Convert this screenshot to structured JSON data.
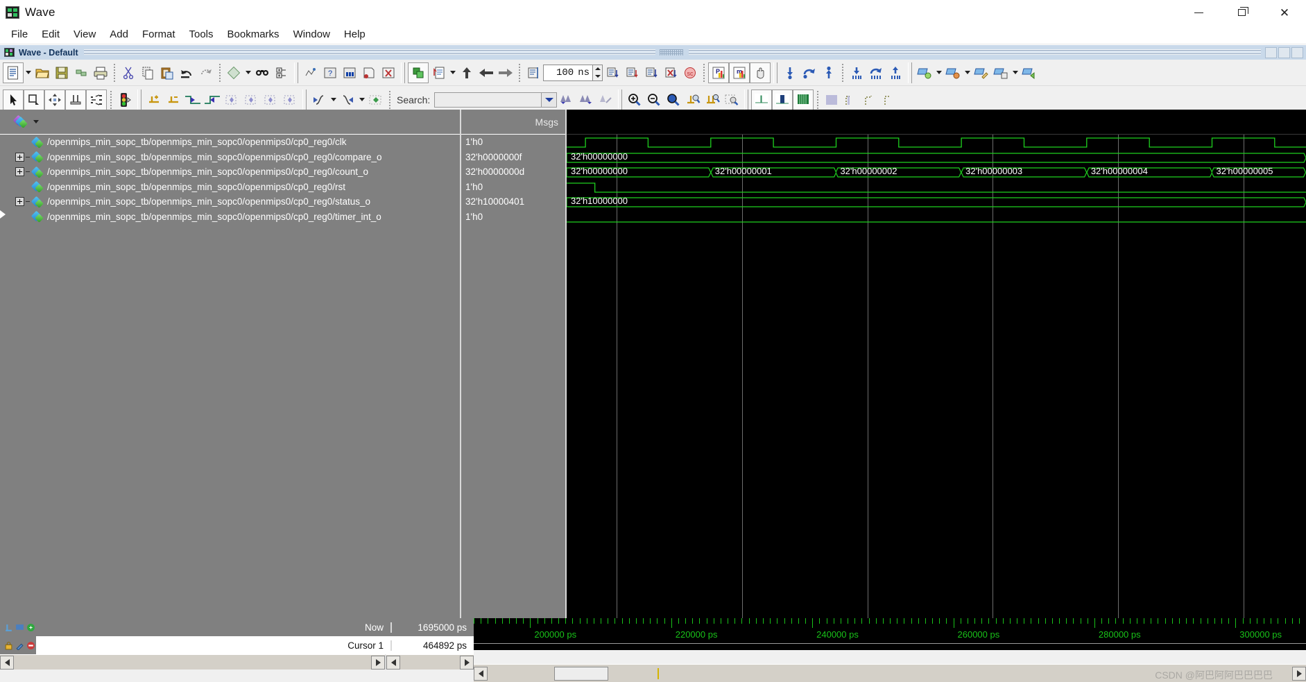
{
  "window": {
    "title": "Wave",
    "icon": "wave-app-icon",
    "controls": {
      "minimize": "—",
      "maximize": "❐",
      "close": "✕"
    }
  },
  "menubar": {
    "items": [
      "File",
      "Edit",
      "View",
      "Add",
      "Format",
      "Tools",
      "Bookmarks",
      "Window",
      "Help"
    ]
  },
  "wave_window": {
    "title": "Wave - Default",
    "icon": "wave-pane-icon"
  },
  "toolbar_top": {
    "zoom_value": "100",
    "zoom_unit": "ns",
    "buttons": [
      "new-file-icon",
      "open-folder-icon",
      "save-icon",
      "reload-icon",
      "print-icon",
      "cut-icon",
      "copy-icon",
      "paste-icon",
      "undo-icon",
      "redo-icon",
      "delete-icon",
      "find-icon",
      "expand-tree-icon",
      "run-icon",
      "run-all-icon",
      "continue-icon",
      "step-icon",
      "break-icon",
      "compile-icon",
      "simulate-icon",
      "step-up-icon",
      "step-back-icon",
      "step-fwd-icon",
      "run-length-icon",
      "restart-icon",
      "run-continue-icon",
      "run-next-icon",
      "stop-icon",
      "profile-icon",
      "memory-icon",
      "hand-pan-icon",
      "insert-cursor-icon",
      "jump-prev-icon",
      "jump-next-icon",
      "insert-marker-icon",
      "wave-compare-icon",
      "wave-expand-icon",
      "bookmark-add-icon",
      "bookmark-del-icon",
      "bookmark-edit-icon",
      "bookmark-save-icon",
      "bookmark-goto-icon"
    ]
  },
  "toolbar_bottom": {
    "search_label": "Search:",
    "search_value": "",
    "search_placeholder": "",
    "buttons": [
      "select-mode-icon",
      "zoom-mode-icon",
      "pan-mode-icon",
      "cursor-mode-icon",
      "edit-mode-icon",
      "traffic-light-icon",
      "insert-cursor-icon",
      "delete-cursor-icon",
      "prev-transition-icon",
      "next-transition-icon",
      "find-prev-icon",
      "find-next-icon",
      "find-falling-icon",
      "find-rising-icon",
      "search-prev-icon",
      "search-next-icon",
      "search-diamond-icon",
      "search-dropdown-icon",
      "search-rev-icon",
      "search-fwd-icon",
      "search-clear-icon",
      "zoom-in-icon",
      "zoom-out-icon",
      "zoom-full-icon",
      "zoom-cursor-icon",
      "zoom-range-icon",
      "zoom-select-icon",
      "wave-single-icon",
      "wave-filled-icon",
      "wave-all-icon",
      "grid-icon",
      "grid-left-icon",
      "grid-mid-icon",
      "grid-right-icon"
    ]
  },
  "panes": {
    "names_header": "",
    "values_header": "Msgs"
  },
  "signals": [
    {
      "name": "/openmips_min_sopc_tb/openmips_min_sopc0/openmips0/cp0_reg0/clk",
      "value": "1'h0",
      "expandable": false,
      "kind": "clock"
    },
    {
      "name": "/openmips_min_sopc_tb/openmips_min_sopc0/openmips0/cp0_reg0/compare_o",
      "value": "32'h0000000f",
      "expandable": true,
      "kind": "bus"
    },
    {
      "name": "/openmips_min_sopc_tb/openmips_min_sopc0/openmips0/cp0_reg0/count_o",
      "value": "32'h0000000d",
      "expandable": true,
      "kind": "bus"
    },
    {
      "name": "/openmips_min_sopc_tb/openmips_min_sopc0/openmips0/cp0_reg0/rst",
      "value": "1'h0",
      "expandable": false,
      "kind": "logic"
    },
    {
      "name": "/openmips_min_sopc_tb/openmips_min_sopc0/openmips0/cp0_reg0/status_o",
      "value": "32'h10000401",
      "expandable": true,
      "kind": "bus"
    },
    {
      "name": "/openmips_min_sopc_tb/openmips_min_sopc0/openmips0/cp0_reg0/timer_int_o",
      "value": "1'h0",
      "expandable": false,
      "kind": "logic"
    }
  ],
  "status": {
    "now_label": "Now",
    "now_value": "1695000 ps",
    "cursor_label": "Cursor 1",
    "cursor_value": "464892 ps"
  },
  "chart_data": {
    "type": "timing-diagram",
    "title": "Wave - Default",
    "time_unit": "ps",
    "x_axis": {
      "tick_labels": [
        "200000 ps",
        "220000 ps",
        "240000 ps",
        "260000 ps",
        "280000 ps",
        "300000 ps"
      ],
      "tick_values": [
        200000,
        220000,
        240000,
        260000,
        280000,
        300000
      ],
      "minor_ticks_per_major": 20,
      "range": [
        192000,
        310000
      ]
    },
    "cursor_time": 464892,
    "now_time": 1695000,
    "waves": [
      {
        "name": "clk",
        "type": "digital",
        "transitions": [
          {
            "t": 192000,
            "v": 0
          },
          {
            "t": 195000,
            "v": 1
          },
          {
            "t": 205000,
            "v": 0
          },
          {
            "t": 215000,
            "v": 1
          },
          {
            "t": 225000,
            "v": 0
          },
          {
            "t": 235000,
            "v": 1
          },
          {
            "t": 245000,
            "v": 0
          },
          {
            "t": 255000,
            "v": 1
          },
          {
            "t": 265000,
            "v": 0
          },
          {
            "t": 275000,
            "v": 1
          },
          {
            "t": 285000,
            "v": 0
          },
          {
            "t": 295000,
            "v": 1
          },
          {
            "t": 305000,
            "v": 0
          }
        ]
      },
      {
        "name": "compare_o",
        "type": "bus",
        "segments": [
          {
            "t": 192000,
            "value": "32'h00000000"
          }
        ]
      },
      {
        "name": "count_o",
        "type": "bus",
        "segments": [
          {
            "t": 192000,
            "value": "32'h00000000"
          },
          {
            "t": 215000,
            "value": "32'h00000001"
          },
          {
            "t": 235000,
            "value": "32'h00000002"
          },
          {
            "t": 255000,
            "value": "32'h00000003"
          },
          {
            "t": 275000,
            "value": "32'h00000004"
          },
          {
            "t": 295000,
            "value": "32'h00000005"
          }
        ]
      },
      {
        "name": "rst",
        "type": "digital",
        "transitions": [
          {
            "t": 192000,
            "v": 1
          },
          {
            "t": 196500,
            "v": 0
          }
        ]
      },
      {
        "name": "status_o",
        "type": "bus",
        "segments": [
          {
            "t": 192000,
            "value": "32'h10000000"
          }
        ]
      },
      {
        "name": "timer_int_o",
        "type": "digital",
        "transitions": [
          {
            "t": 192000,
            "v": 0
          }
        ]
      }
    ],
    "colors": {
      "wave": "#1fd11f",
      "grid": "#6e6e6e",
      "background": "#000000",
      "axis_text": "#19c219",
      "cursor": "#c8b400"
    }
  },
  "watermark": {
    "text": "CSDN @阿巴阿阿巴巴巴巴"
  },
  "theme": {
    "accent": "#1fd11f",
    "pane_bg": "#808080",
    "wave_bg": "#000000",
    "titlebar_bg": "#c9d9ea"
  }
}
